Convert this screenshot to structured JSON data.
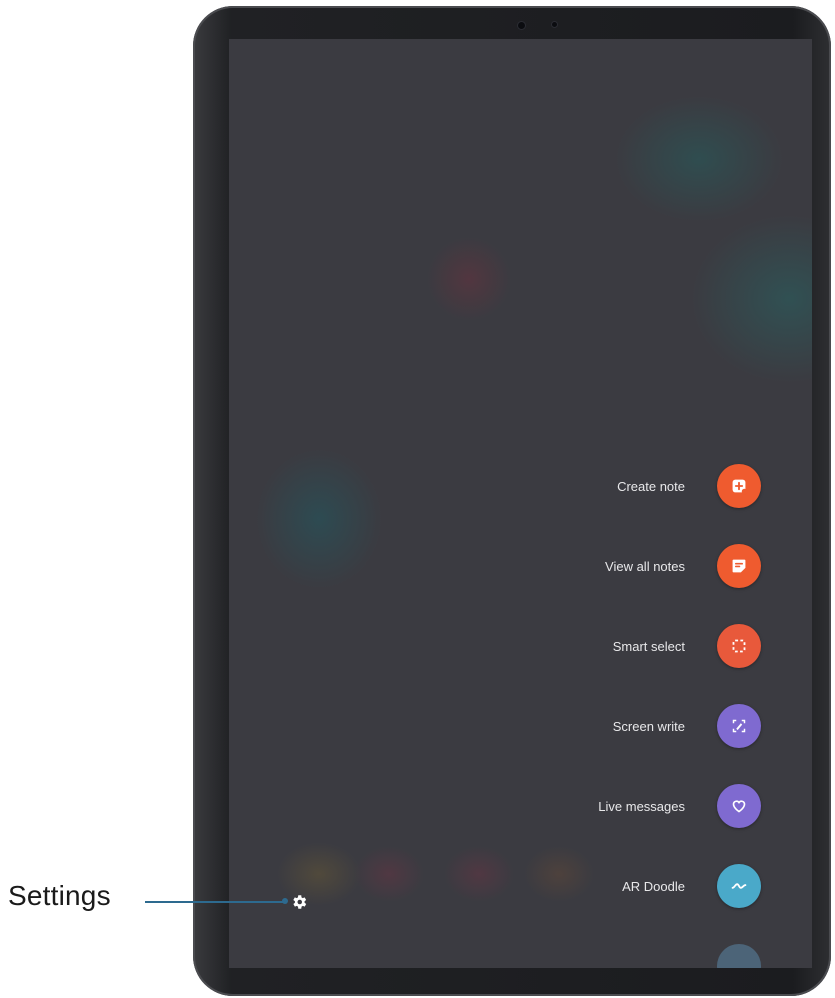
{
  "air_command": {
    "items": [
      {
        "label": "Create note",
        "icon": "create-note-icon",
        "color": "#ef5b2f"
      },
      {
        "label": "View all notes",
        "icon": "view-notes-icon",
        "color": "#ef5b2f"
      },
      {
        "label": "Smart select",
        "icon": "smart-select-icon",
        "color": "#e8593b"
      },
      {
        "label": "Screen write",
        "icon": "screen-write-icon",
        "color": "#7f6ad0"
      },
      {
        "label": "Live messages",
        "icon": "live-messages-icon",
        "color": "#7f6ad0"
      },
      {
        "label": "AR Doodle",
        "icon": "ar-doodle-icon",
        "color": "#4aa9c9"
      }
    ],
    "settings_icon": "gear-icon"
  },
  "callout": {
    "label": "Settings",
    "line_color": "#2d6a8f"
  }
}
